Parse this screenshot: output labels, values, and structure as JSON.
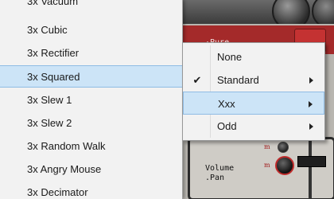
{
  "list_menu": {
    "items": [
      {
        "label": "3x Vacuum"
      },
      {
        "label": "3x Cubic"
      },
      {
        "label": "3x Rectifier"
      },
      {
        "label": "3x Squared",
        "highlighted": true
      },
      {
        "label": "3x Slew 1"
      },
      {
        "label": "3x Slew 2"
      },
      {
        "label": "3x Random Walk"
      },
      {
        "label": "3x Angry Mouse"
      },
      {
        "label": "3x Decimator"
      }
    ]
  },
  "submenu": {
    "items": [
      {
        "label": "None",
        "checked": false,
        "has_submenu": false
      },
      {
        "label": "Standard",
        "checked": true,
        "has_submenu": true
      },
      {
        "label": "Xxx",
        "checked": false,
        "has_submenu": true,
        "highlighted": true
      },
      {
        "label": "Odd",
        "checked": false,
        "has_submenu": true
      }
    ],
    "check_glyph": "✔"
  },
  "plugin": {
    "volume_label": "Volume\n.Pan",
    "partial_label": "·Pure"
  },
  "colors": {
    "highlight": "#cce4f7",
    "highlight_border": "#8fbce4",
    "menu_bg": "#f2f2f2",
    "accent_red": "#a42a2a"
  }
}
